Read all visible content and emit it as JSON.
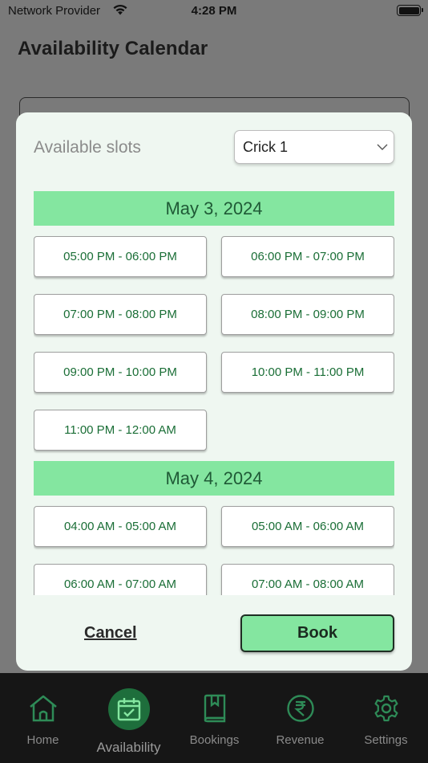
{
  "status_bar": {
    "carrier": "Network Provider",
    "time": "4:28 PM"
  },
  "page": {
    "title": "Availability Calendar"
  },
  "modal": {
    "title": "Available slots",
    "ground_select": {
      "value": "Crick 1"
    },
    "days": [
      {
        "date": "May 3, 2024",
        "slots": [
          "05:00 PM - 06:00 PM",
          "06:00 PM - 07:00 PM",
          "07:00 PM - 08:00 PM",
          "08:00 PM - 09:00 PM",
          "09:00 PM - 10:00 PM",
          "10:00 PM - 11:00 PM",
          "11:00 PM - 12:00 AM"
        ]
      },
      {
        "date": "May 4, 2024",
        "slots": [
          "04:00 AM - 05:00 AM",
          "05:00 AM - 06:00 AM",
          "06:00 AM - 07:00 AM",
          "07:00 AM - 08:00 AM"
        ]
      }
    ],
    "cancel_label": "Cancel",
    "book_label": "Book"
  },
  "tabbar": {
    "tabs": [
      {
        "label": "Home",
        "icon": "home-icon"
      },
      {
        "label": "Availability",
        "icon": "calendar-check-icon",
        "active": true
      },
      {
        "label": "Bookings",
        "icon": "book-icon"
      },
      {
        "label": "Revenue",
        "icon": "rupee-icon"
      },
      {
        "label": "Settings",
        "icon": "gear-icon"
      }
    ]
  },
  "colors": {
    "accent": "#84e6a0",
    "slot_text": "#1a6e36",
    "tab_icon": "#2e8b57",
    "active_tab_bg": "#1e6e3c"
  }
}
